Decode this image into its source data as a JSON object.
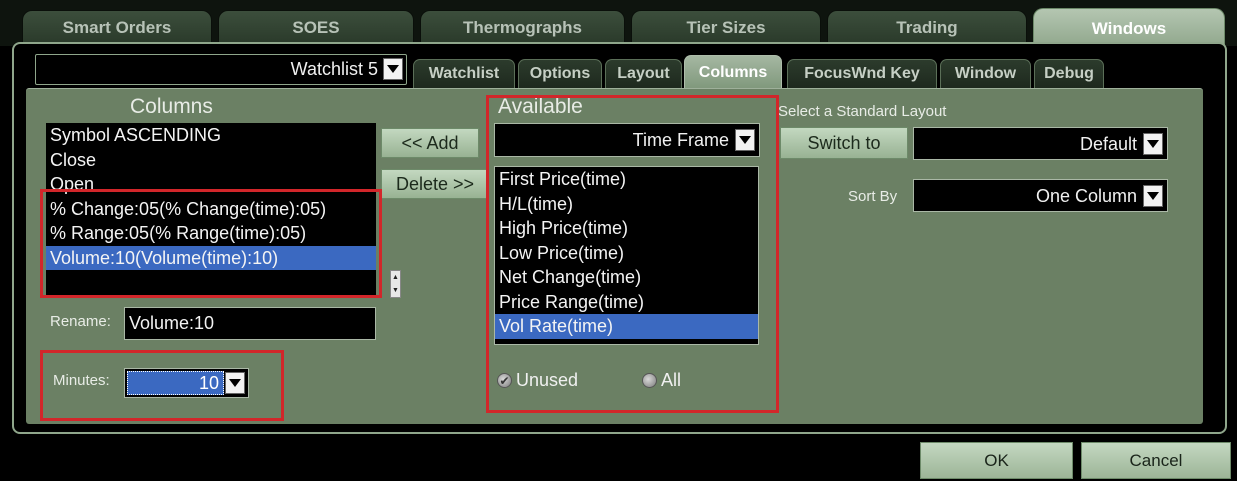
{
  "top_tabs": [
    {
      "label": "Smart Orders"
    },
    {
      "label": "SOES"
    },
    {
      "label": "Thermographs"
    },
    {
      "label": "Tier Sizes"
    },
    {
      "label": "Trading"
    },
    {
      "label": "Windows"
    }
  ],
  "watchlist": {
    "value": "Watchlist 5"
  },
  "sub_tabs": [
    {
      "label": "Watchlist"
    },
    {
      "label": "Options"
    },
    {
      "label": "Layout"
    },
    {
      "label": "Columns"
    },
    {
      "label": "FocusWnd Key"
    },
    {
      "label": "Window"
    },
    {
      "label": "Debug"
    }
  ],
  "columns": {
    "title": "Columns",
    "items": [
      "Symbol ASCENDING",
      "Close",
      "Open",
      "% Change:05(% Change(time):05)",
      "% Range:05(% Range(time):05)",
      "Volume:10(Volume(time):10)"
    ],
    "selected_index": 5
  },
  "buttons": {
    "add": "<< Add",
    "delete": "Delete >>",
    "switch_to": "Switch to",
    "ok": "OK",
    "cancel": "Cancel"
  },
  "rename": {
    "label": "Rename:",
    "value": "Volume:10"
  },
  "minutes": {
    "label": "Minutes:",
    "value": "10"
  },
  "available": {
    "title": "Available",
    "filter_value": "Time Frame",
    "items": [
      "First Price(time)",
      "H/L(time)",
      "High Price(time)",
      "Low Price(time)",
      "Net Change(time)",
      "Price Range(time)",
      "Vol Rate(time)"
    ],
    "selected_index": 6,
    "radio_unused": "Unused",
    "radio_all": "All"
  },
  "standard_layout": {
    "label": "Select a Standard Layout",
    "value": "Default",
    "sort_label": "Sort By",
    "sort_value": "One Column"
  },
  "colors": {
    "selection": "#3b69c1",
    "highlight_box": "#d2262a",
    "panel_bg": "#6b8064",
    "active_tab": "#a5b7a2"
  }
}
